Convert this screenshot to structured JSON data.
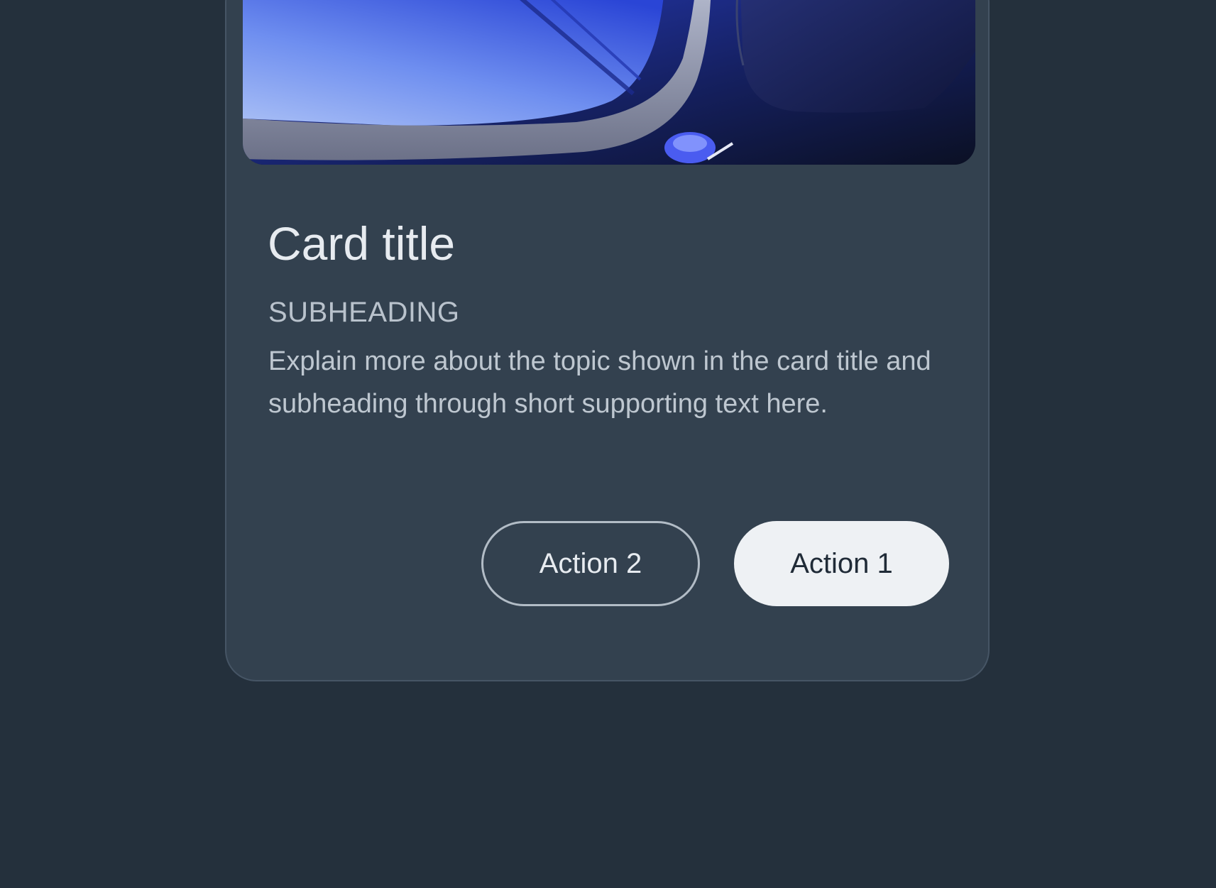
{
  "card": {
    "title": "Card title",
    "subheading": "SUBHEADING",
    "body": "Explain more about the topic shown in the card title and subheading through short supporting text here.",
    "media_alt": "car-interior-image"
  },
  "actions": {
    "secondary_label": "Action 2",
    "primary_label": "Action 1"
  },
  "colors": {
    "background": "#24303c",
    "card_surface": "#33414f",
    "primary_button": "#eef1f4",
    "accent_blue": "#3b55e0"
  }
}
